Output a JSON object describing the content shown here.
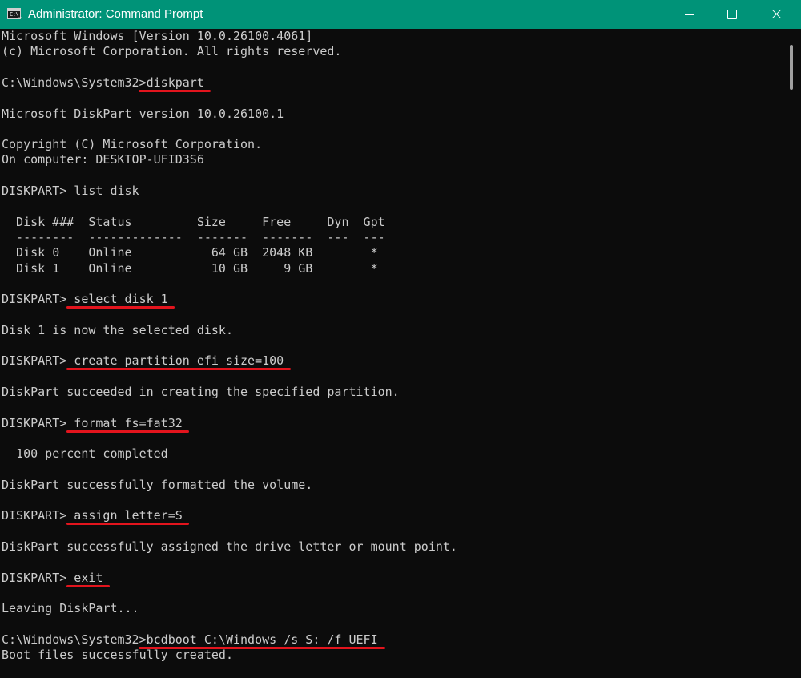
{
  "window": {
    "title": "Administrator: Command Prompt",
    "icon_label": "C:\\_",
    "icon_name": "cmd-icon"
  },
  "colors": {
    "titlebar": "#009378",
    "console_bg": "#0c0c0c",
    "console_text": "#cccccc",
    "annotation_underline": "#e3141d"
  },
  "console": {
    "lines": [
      "Microsoft Windows [Version 10.0.26100.4061]",
      "(c) Microsoft Corporation. All rights reserved.",
      "",
      "C:\\Windows\\System32>diskpart",
      "",
      "Microsoft DiskPart version 10.0.26100.1",
      "",
      "Copyright (C) Microsoft Corporation.",
      "On computer: DESKTOP-UFID3S6",
      "",
      "DISKPART> list disk",
      "",
      "  Disk ###  Status         Size     Free     Dyn  Gpt",
      "  --------  -------------  -------  -------  ---  ---",
      "  Disk 0    Online           64 GB  2048 KB        *",
      "  Disk 1    Online           10 GB     9 GB        *",
      "",
      "DISKPART> select disk 1",
      "",
      "Disk 1 is now the selected disk.",
      "",
      "DISKPART> create partition efi size=100",
      "",
      "DiskPart succeeded in creating the specified partition.",
      "",
      "DISKPART> format fs=fat32",
      "",
      "  100 percent completed",
      "",
      "DiskPart successfully formatted the volume.",
      "",
      "DISKPART> assign letter=S",
      "",
      "DiskPart successfully assigned the drive letter or mount point.",
      "",
      "DISKPART> exit",
      "",
      "Leaving DiskPart...",
      "",
      "C:\\Windows\\System32>bcdboot C:\\Windows /s S: /f UEFI",
      "Boot files successfully created."
    ],
    "highlighted_commands": [
      "diskpart",
      "select disk 1",
      "create partition efi size=100",
      "format fs=fat32",
      "assign letter=S",
      "exit",
      "bcdboot C:\\Windows /s S: /f UEFI"
    ]
  }
}
